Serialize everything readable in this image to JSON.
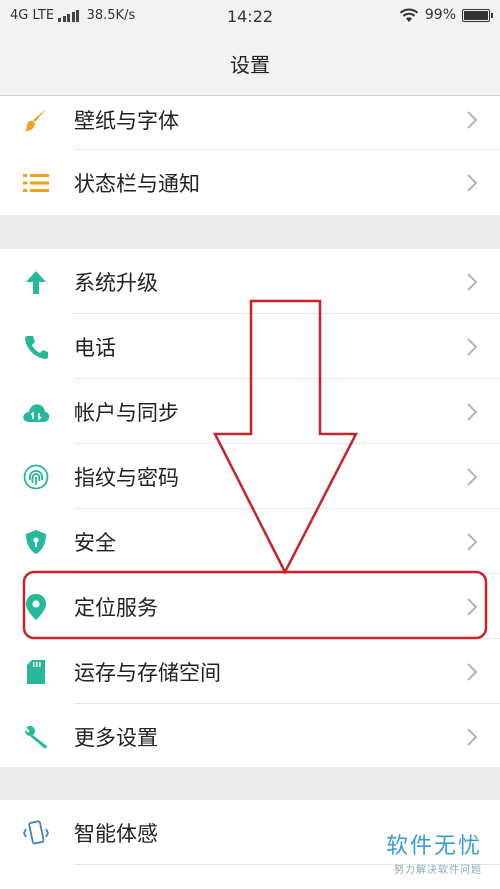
{
  "status_bar": {
    "network": "4G LTE",
    "speed": "38.5K/s",
    "time": "14:22",
    "battery": "99%",
    "battery_level": 0.99
  },
  "header": {
    "title": "设置"
  },
  "groups": [
    {
      "items": [
        {
          "label": "壁纸与字体",
          "icon": "paintbrush-icon"
        },
        {
          "label": "状态栏与通知",
          "icon": "list-lines-icon"
        }
      ]
    },
    {
      "items": [
        {
          "label": "系统升级",
          "icon": "arrow-up-icon"
        },
        {
          "label": "电话",
          "icon": "phone-icon"
        },
        {
          "label": "帐户与同步",
          "icon": "cloud-sync-icon"
        },
        {
          "label": "指纹与密码",
          "icon": "fingerprint-icon"
        },
        {
          "label": "安全",
          "icon": "shield-icon"
        },
        {
          "label": "定位服务",
          "icon": "location-pin-icon"
        },
        {
          "label": "运存与存储空间",
          "icon": "sd-card-icon"
        },
        {
          "label": "更多设置",
          "icon": "wrench-icon"
        }
      ]
    },
    {
      "items": [
        {
          "label": "智能体感",
          "icon": "phone-motion-icon"
        },
        {
          "label": "",
          "icon": "partial-icon"
        }
      ]
    }
  ],
  "watermark": {
    "main": "软件无忧",
    "sub": "努力解决软件问题"
  },
  "colors": {
    "accent_teal": "#26b89a",
    "accent_orange": "#f0a020",
    "annotation_red": "#c8232c",
    "watermark_blue": "#3a9bd6"
  }
}
